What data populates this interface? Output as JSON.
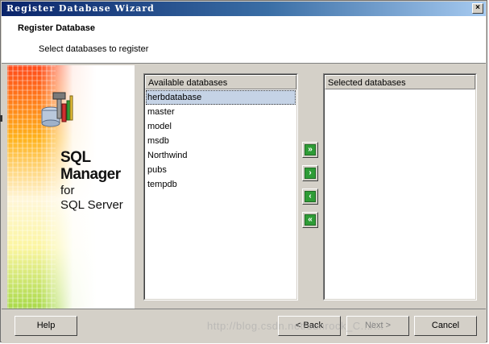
{
  "window": {
    "title": "Register Database Wizard",
    "close_label": "×"
  },
  "header": {
    "title": "Register Database",
    "subtitle": "Select databases to register"
  },
  "banner": {
    "line1": "SQL",
    "line2": "Manager",
    "line3": "for",
    "line4": "SQL Server"
  },
  "available": {
    "header": "Available databases",
    "items": [
      "herbdatabase",
      "master",
      "model",
      "msdb",
      "Northwind",
      "pubs",
      "tempdb"
    ],
    "selected_index": 0
  },
  "selected": {
    "header": "Selected databases",
    "items": []
  },
  "transfer": {
    "add_all_icon": "double-chevron-right-icon",
    "add_icon": "chevron-right-icon",
    "remove_icon": "chevron-left-icon",
    "remove_all_icon": "double-chevron-left-icon",
    "add_all_glyph": "»",
    "add_glyph": "›",
    "remove_glyph": "‹",
    "remove_all_glyph": "«"
  },
  "footer": {
    "help": "Help",
    "back": "< Back",
    "next": "Next >",
    "cancel": "Cancel"
  },
  "watermark": "http://blog.csdn.net/sunrock_C.../...",
  "colors": {
    "title_start": "#0a246a",
    "title_end": "#a6caf0",
    "selection": "#c5d3e6",
    "transfer_button": "#2e9c36"
  }
}
